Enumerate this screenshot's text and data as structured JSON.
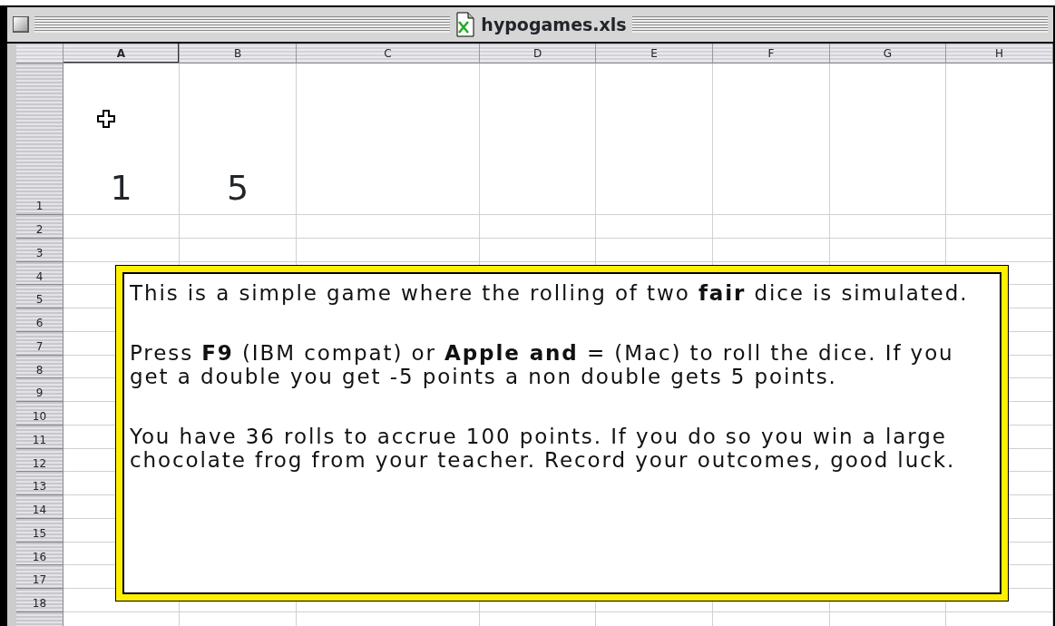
{
  "window": {
    "title": "hypogames.xls"
  },
  "columns": [
    {
      "label": "A",
      "selected": true
    },
    {
      "label": "B",
      "selected": false
    },
    {
      "label": "C",
      "selected": false
    },
    {
      "label": "D",
      "selected": false
    },
    {
      "label": "E",
      "selected": false
    },
    {
      "label": "F",
      "selected": false
    },
    {
      "label": "G",
      "selected": false
    },
    {
      "label": "H",
      "selected": false
    }
  ],
  "rows": [
    {
      "label": "1",
      "cells": [
        "1",
        "5"
      ]
    },
    {
      "label": "2"
    },
    {
      "label": "3"
    },
    {
      "label": "4"
    },
    {
      "label": "5"
    },
    {
      "label": "6"
    },
    {
      "label": "7"
    },
    {
      "label": "8"
    },
    {
      "label": "9"
    },
    {
      "label": "10"
    },
    {
      "label": "11"
    },
    {
      "label": "12"
    },
    {
      "label": "13"
    },
    {
      "label": "14"
    },
    {
      "label": "15"
    },
    {
      "label": "16"
    },
    {
      "label": "17"
    },
    {
      "label": "18"
    }
  ],
  "text_box": {
    "paragraphs": [
      "This is a simple game where the rolling of two **fair** dice is simulated.",
      "Press **F9** (IBM compat) or **Apple and** = (Mac) to roll the dice. If you get a double you get -5 points a non double gets 5 points.",
      "You have 36 rolls to accrue 100 points. If you do so you win a large chocolate frog from your teacher. Record your outcomes, good luck."
    ]
  }
}
